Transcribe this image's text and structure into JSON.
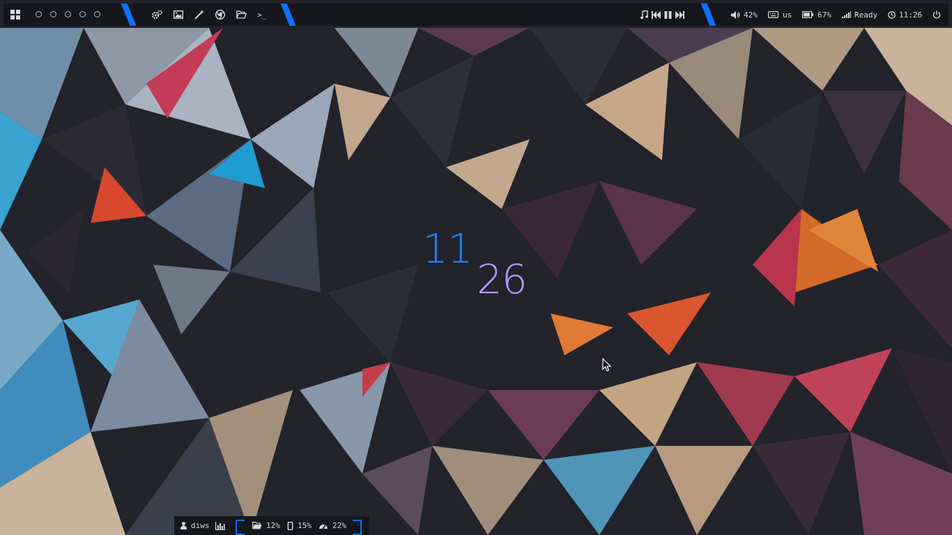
{
  "top_bar": {
    "launcher_icon": "grid-icon",
    "workspaces": [
      "ws-1",
      "ws-2",
      "ws-3",
      "ws-4",
      "ws-5"
    ],
    "app_launchers": [
      {
        "name": "settings-icon"
      },
      {
        "name": "image-icon"
      },
      {
        "name": "magic-wand-icon"
      },
      {
        "name": "browser-icon"
      },
      {
        "name": "folder-icon"
      },
      {
        "name": "terminal-icon",
        "glyph": ">_"
      }
    ],
    "media": {
      "music_icon": "music-icon",
      "prev_icon": "skip-back-icon",
      "pause_icon": "pause-icon",
      "next_icon": "skip-forward-icon"
    },
    "volume": "42%",
    "keyboard_layout": "us",
    "battery": "67%",
    "network_status": "Ready",
    "time": "11:26",
    "accent_color": "#1270ff"
  },
  "clock_widget": {
    "hour": "11",
    "minute": "26",
    "hour_color": "#1b84ff",
    "minute_color": "#b79aff"
  },
  "bottom_bar": {
    "user": "diws",
    "disk": "12%",
    "memory": "15%",
    "cpu": "22%"
  }
}
